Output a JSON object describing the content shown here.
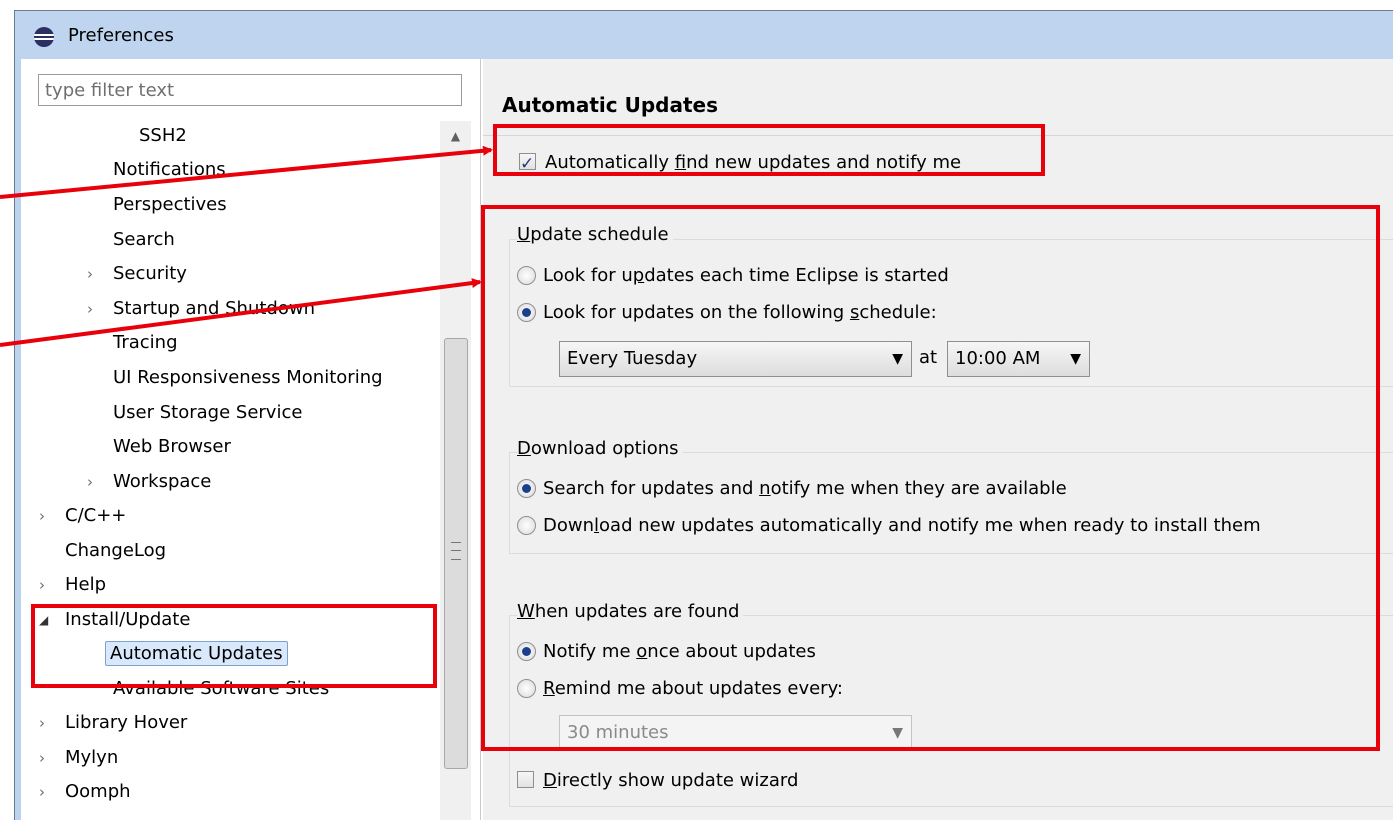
{
  "window": {
    "title": "Preferences"
  },
  "filter": {
    "placeholder": "type filter text"
  },
  "tree": {
    "items": [
      {
        "label": "SSH2"
      },
      {
        "label": "Notifications"
      },
      {
        "label": "Perspectives"
      },
      {
        "label": "Search"
      },
      {
        "label": "Security"
      },
      {
        "label": "Startup and Shutdown"
      },
      {
        "label": "Tracing"
      },
      {
        "label": "UI Responsiveness Monitoring"
      },
      {
        "label": "User Storage Service"
      },
      {
        "label": "Web Browser"
      },
      {
        "label": "Workspace"
      },
      {
        "label": "C/C++"
      },
      {
        "label": "ChangeLog"
      },
      {
        "label": "Help"
      },
      {
        "label": "Install/Update"
      },
      {
        "label": "Automatic Updates"
      },
      {
        "label": "Available Software Sites"
      },
      {
        "label": "Library Hover"
      },
      {
        "label": "Mylyn"
      },
      {
        "label": "Oomph"
      }
    ]
  },
  "page": {
    "title": "Automatic Updates",
    "auto_find": {
      "label_pre": "Automatically ",
      "label_u": "f",
      "label_post": "ind new updates and notify me",
      "checked": true
    },
    "schedule": {
      "title_u": "U",
      "title_rest": "pdate schedule",
      "opt1": {
        "pre": "Look for u",
        "u": "p",
        "post": "dates each time Eclipse is started"
      },
      "opt2": {
        "pre": "Look for updates on the following ",
        "u": "s",
        "post": "chedule:"
      },
      "day": "Every Tuesday",
      "at": "at",
      "time": "10:00 AM"
    },
    "download": {
      "title_u": "D",
      "title_rest": "ownload options",
      "opt1": {
        "pre": "Search for updates and ",
        "u": "n",
        "post": "otify me when they are available"
      },
      "opt2": {
        "pre": "Down",
        "u": "l",
        "post": "oad new updates automatically and notify me when ready to install them"
      }
    },
    "found": {
      "title_u": "W",
      "title_rest": "hen updates are found",
      "opt1": {
        "pre": "Notify me ",
        "u": "o",
        "post": "nce about updates"
      },
      "opt2": {
        "pre": "",
        "u": "R",
        "post": "emind me about updates every:"
      },
      "interval": "30 minutes"
    },
    "wizard": {
      "pre": "",
      "u": "D",
      "post": "irectly show update wizard",
      "checked": false
    }
  },
  "annotation": {
    "color": "#e8000a"
  }
}
